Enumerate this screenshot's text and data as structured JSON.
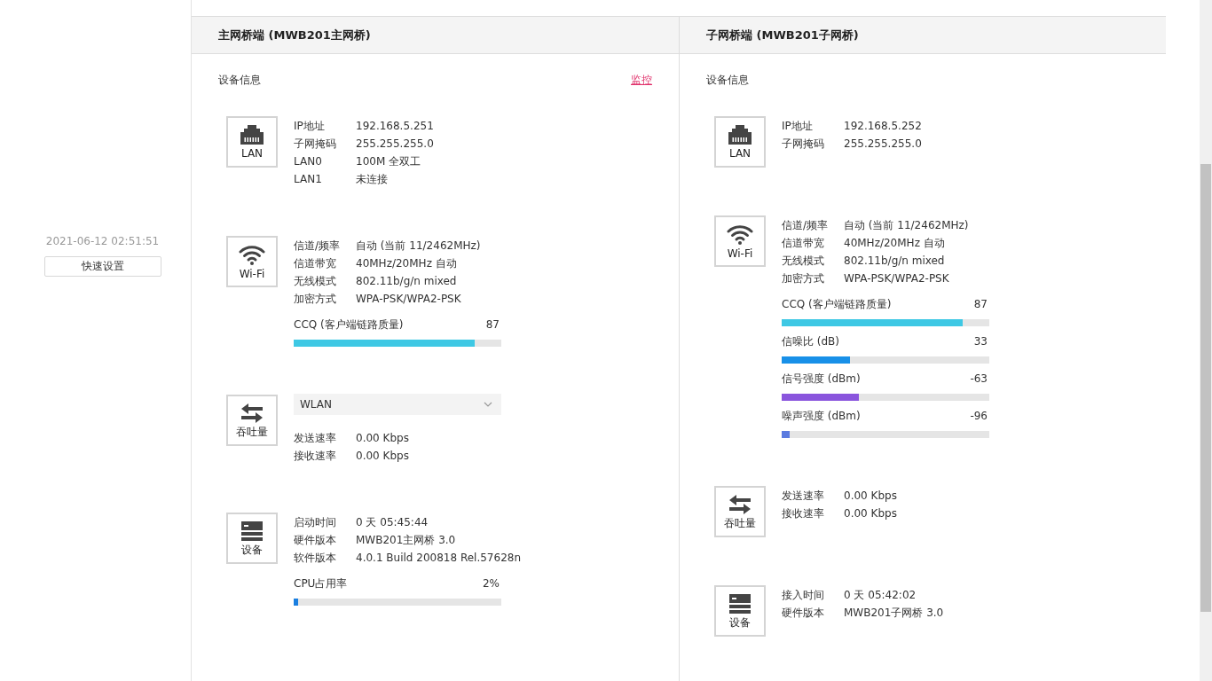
{
  "sidebar": {
    "timestamp": "2021-06-12 02:51:51",
    "quick_setup_button": "快速设置"
  },
  "panels": [
    {
      "title": "主网桥端 (MWB201主网桥)",
      "section_title": "设备信息",
      "link": "监控",
      "groups": [
        {
          "kind": "lan",
          "icon_label": "LAN",
          "rows": [
            {
              "label": "IP地址",
              "value": "192.168.5.251"
            },
            {
              "label": "子网掩码",
              "value": "255.255.255.0"
            },
            {
              "label": "LAN0",
              "value": "100M 全双工"
            },
            {
              "label": "LAN1",
              "value": "未连接"
            }
          ]
        },
        {
          "kind": "wifi",
          "icon_label": "Wi-Fi",
          "rows": [
            {
              "label": "信道/频率",
              "value": "自动 (当前 11/2462MHz)"
            },
            {
              "label": "信道带宽",
              "value": "40MHz/20MHz 自动"
            },
            {
              "label": "无线模式",
              "value": "802.11b/g/n mixed"
            },
            {
              "label": "加密方式",
              "value": "WPA-PSK/WPA2-PSK"
            }
          ],
          "meters": [
            {
              "label": "CCQ (客户端链路质量)",
              "reading": "87",
              "level": 0.87,
              "color": "#3ec8e4"
            }
          ]
        },
        {
          "kind": "throughput",
          "icon_label": "吞吐量",
          "select": "WLAN",
          "rows": [
            {
              "label": "发送速率",
              "value": "0.00 Kbps"
            },
            {
              "label": "接收速率",
              "value": "0.00 Kbps"
            }
          ]
        },
        {
          "kind": "device",
          "icon_label": "设备",
          "rows": [
            {
              "label": "启动时间",
              "value": "0 天 05:45:44"
            },
            {
              "label": "硬件版本",
              "value": "MWB201主网桥 3.0"
            },
            {
              "label": "软件版本",
              "value": "4.0.1 Build 200818 Rel.57628n"
            }
          ],
          "meters": [
            {
              "label": "CPU占用率",
              "reading": "2%",
              "level": 0.02,
              "color": "#1a7fe0"
            }
          ]
        }
      ]
    },
    {
      "title": "子网桥端 (MWB201子网桥)",
      "section_title": "设备信息",
      "groups": [
        {
          "kind": "lan",
          "icon_label": "LAN",
          "rows": [
            {
              "label": "IP地址",
              "value": "192.168.5.252"
            },
            {
              "label": "子网掩码",
              "value": "255.255.255.0"
            }
          ]
        },
        {
          "kind": "wifi",
          "icon_label": "Wi-Fi",
          "rows": [
            {
              "label": "信道/频率",
              "value": "自动 (当前 11/2462MHz)"
            },
            {
              "label": "信道带宽",
              "value": "40MHz/20MHz 自动"
            },
            {
              "label": "无线模式",
              "value": "802.11b/g/n mixed"
            },
            {
              "label": "加密方式",
              "value": "WPA-PSK/WPA2-PSK"
            }
          ],
          "meters": [
            {
              "label": "CCQ (客户端链路质量)",
              "reading": "87",
              "level": 0.87,
              "color": "#3ec8e4"
            },
            {
              "label": "信噪比 (dB)",
              "reading": "33",
              "level": 0.33,
              "color": "#1890e8"
            },
            {
              "label": "信号强度 (dBm)",
              "reading": "-63",
              "level": 0.37,
              "color": "#8a55dd"
            },
            {
              "label": "噪声强度 (dBm)",
              "reading": "-96",
              "level": 0.04,
              "color": "#5b7be0"
            }
          ]
        },
        {
          "kind": "throughput",
          "icon_label": "吞吐量",
          "rows": [
            {
              "label": "发送速率",
              "value": "0.00 Kbps"
            },
            {
              "label": "接收速率",
              "value": "0.00 Kbps"
            }
          ]
        },
        {
          "kind": "device",
          "icon_label": "设备",
          "rows": [
            {
              "label": "接入时间",
              "value": "0 天 05:42:02"
            },
            {
              "label": "硬件版本",
              "value": "MWB201子网桥 3.0"
            }
          ]
        }
      ]
    }
  ]
}
